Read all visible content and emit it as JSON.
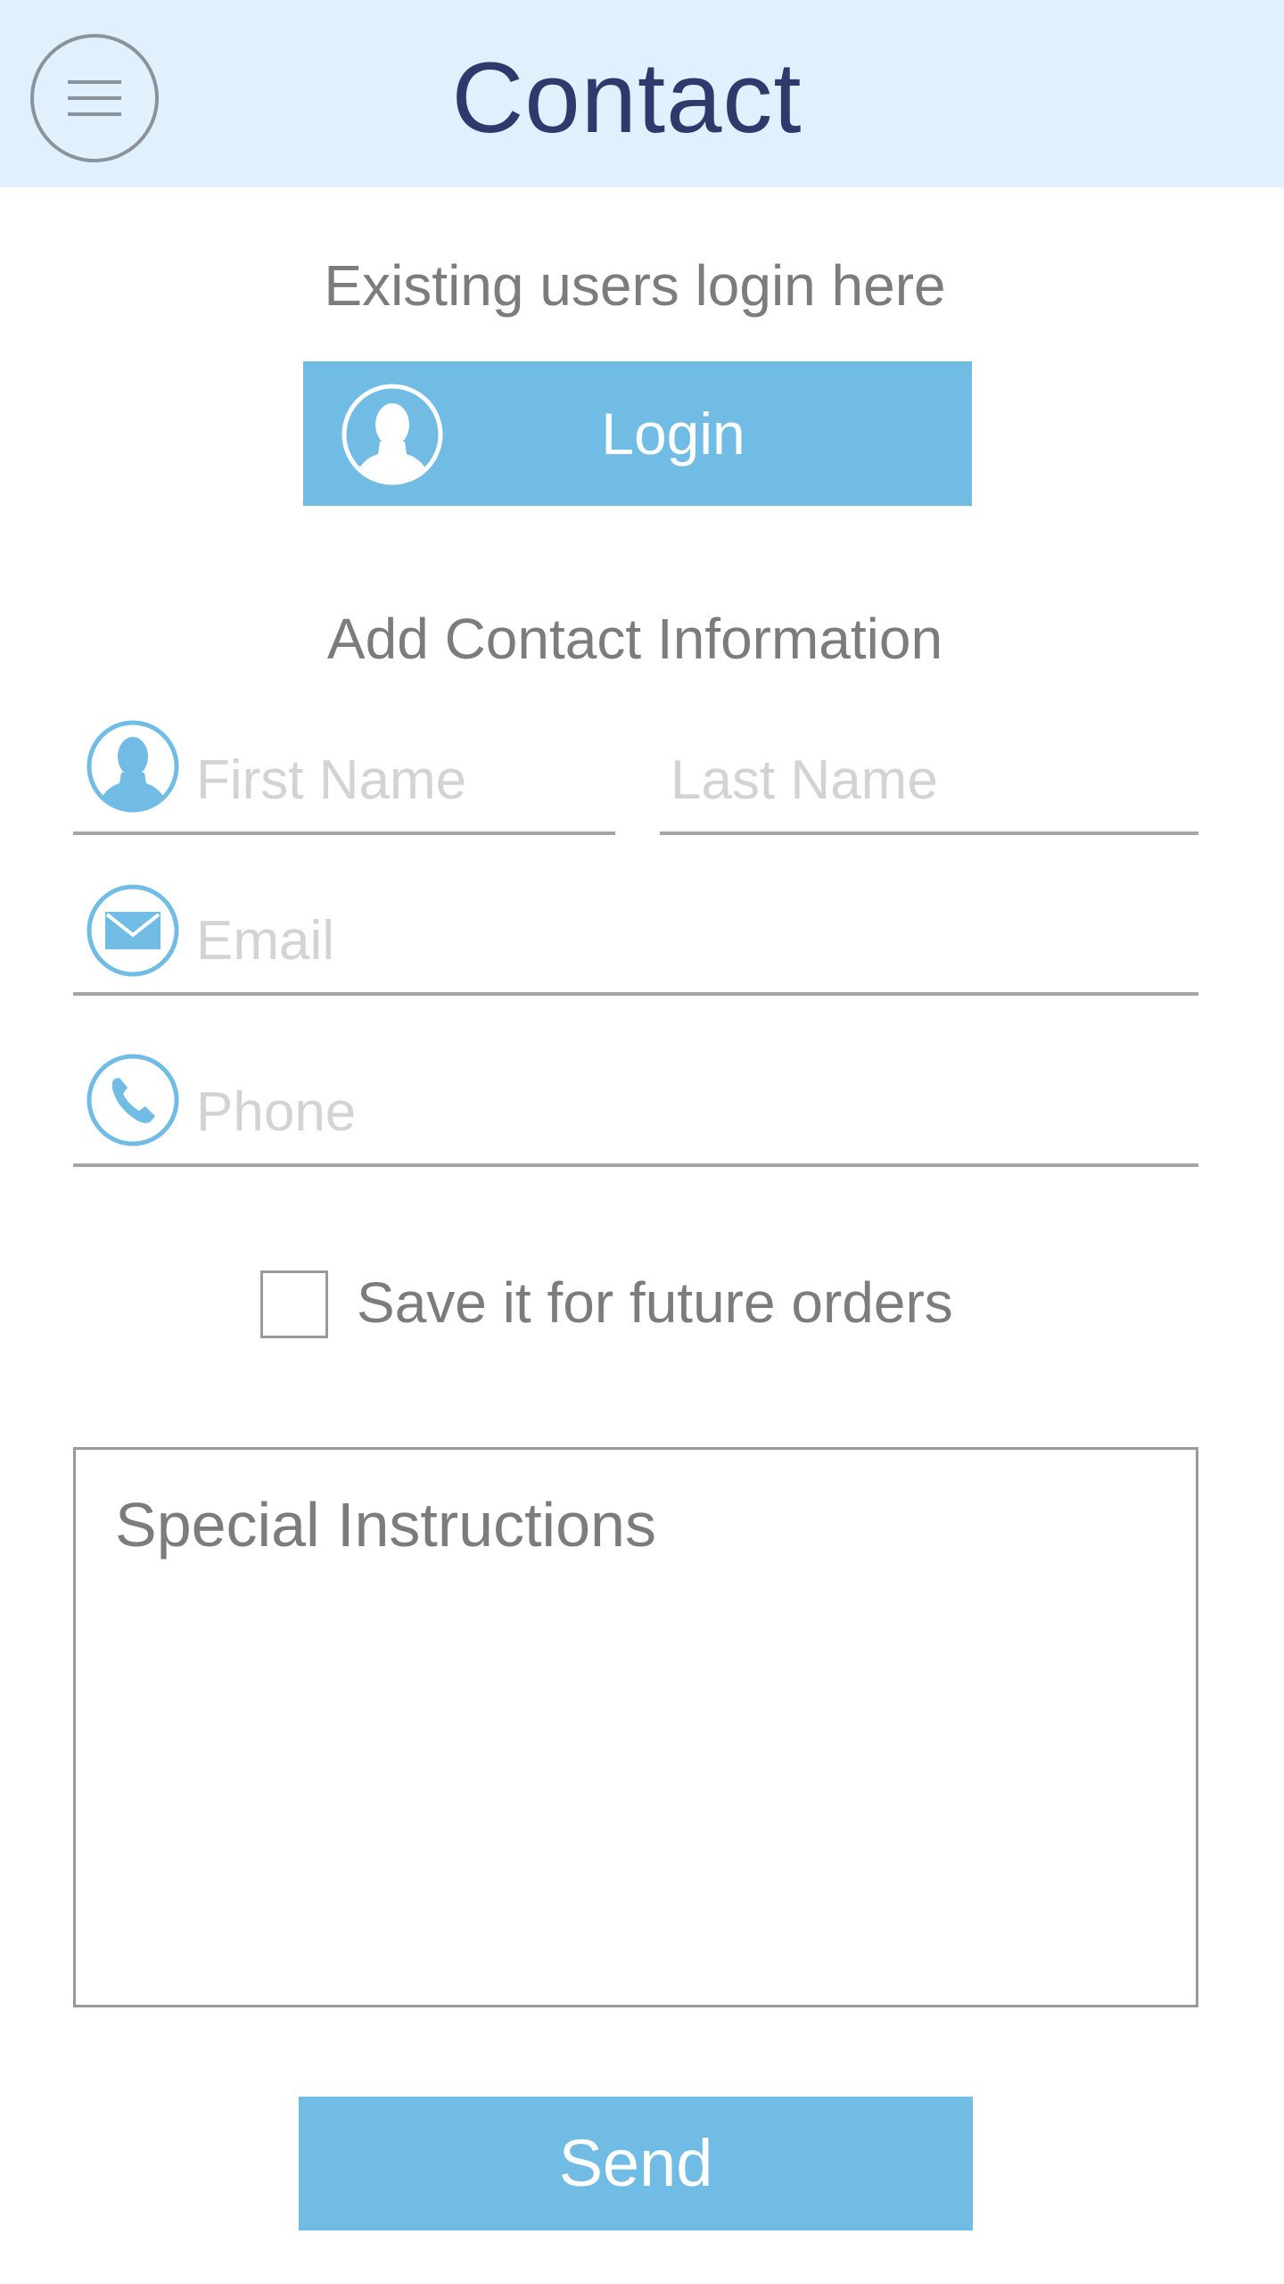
{
  "header": {
    "title": "Contact",
    "menu_icon": "hamburger-menu-icon"
  },
  "login_section": {
    "prompt": "Existing users login here",
    "button_label": "Login",
    "button_icon": "user-avatar-icon"
  },
  "contact_form": {
    "heading": "Add Contact Information",
    "first_name": {
      "value": "",
      "placeholder": "First Name",
      "icon": "user-icon"
    },
    "last_name": {
      "value": "",
      "placeholder": "Last Name"
    },
    "email": {
      "value": "",
      "placeholder": "Email",
      "icon": "envelope-icon"
    },
    "phone": {
      "value": "",
      "placeholder": "Phone",
      "icon": "phone-icon"
    },
    "save_checkbox": {
      "checked": false,
      "label": "Save it for future orders"
    },
    "special_instructions": {
      "value": "",
      "placeholder": "Special Instructions"
    },
    "send_label": "Send"
  },
  "colors": {
    "header_background": "#e1f0fd",
    "title": "#2e3a6b",
    "accent": "#71bce4",
    "label_gray": "#7c7c7c",
    "placeholder_gray": "#d3d3d3",
    "line_gray": "#a5a5a5"
  }
}
